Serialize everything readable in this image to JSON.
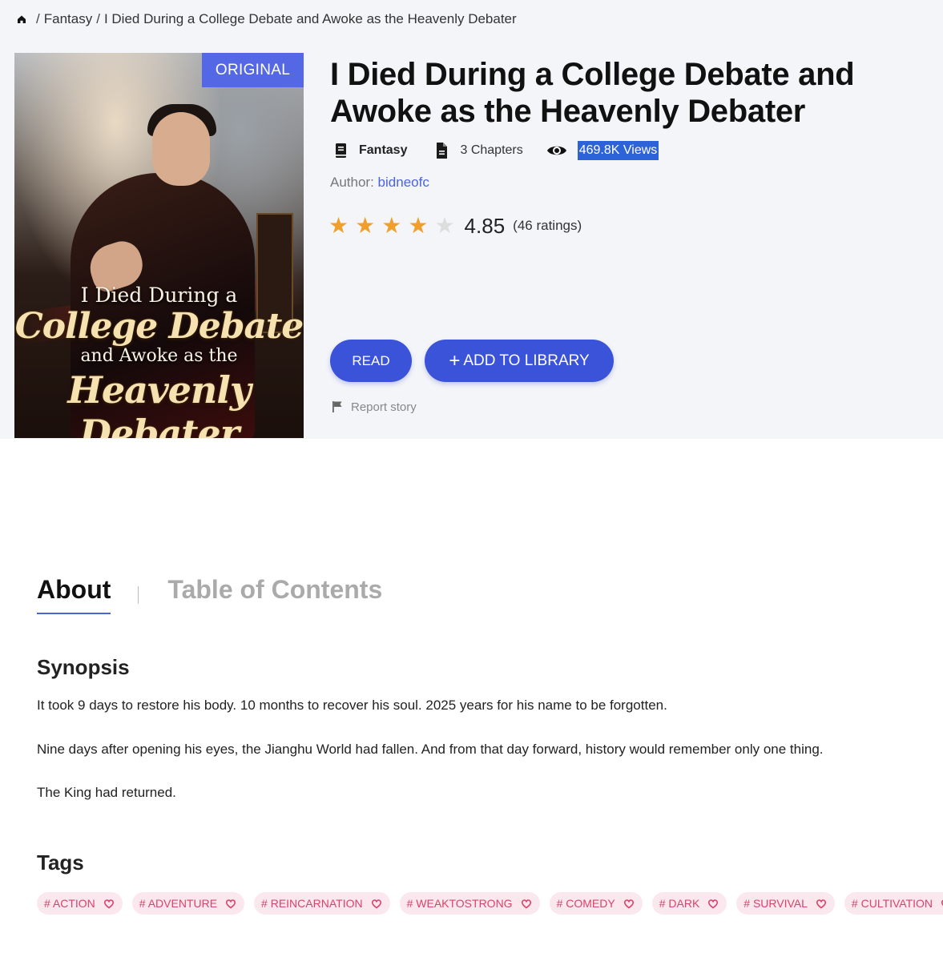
{
  "breadcrumb": {
    "items": [
      "Fantasy",
      "I Died During a College Debate and Awoke as the Heavenly Debater"
    ]
  },
  "cover": {
    "badge": "ORIGINAL",
    "lines": [
      "I Died During a",
      "College Debate",
      "and Awoke as the",
      "Heavenly Debater"
    ]
  },
  "book": {
    "title": "I Died During a College Debate and Awoke as the Heavenly Debater",
    "genre": "Fantasy",
    "chapters": "3 Chapters",
    "views": "469.8K Views",
    "author_label": "Author:",
    "author": "bidneofc",
    "rating": {
      "stars_filled": 4,
      "stars_total": 5,
      "score": "4.85",
      "count": "(46 ratings)"
    }
  },
  "actions": {
    "read": "READ",
    "add_plus": "+",
    "add_to_library": "ADD TO LIBRARY",
    "report": "Report story"
  },
  "tabs": [
    {
      "label": "About",
      "active": true
    },
    {
      "label": "Table of Contents",
      "active": false
    }
  ],
  "synopsis": {
    "heading": "Synopsis",
    "paragraphs": [
      "It took 9 days to restore his body. 10 months to recover his soul. 2025 years for his name to be forgotten.",
      "Nine days after opening his eyes, the Jianghu World had fallen. And from that day forward, history would remember only one thing.",
      "The King had returned."
    ]
  },
  "tags": {
    "heading": "Tags",
    "items": [
      "# ACTION",
      "# ADVENTURE",
      "# REINCARNATION",
      "# WEAKTOSTRONG",
      "# COMEDY",
      "# DARK",
      "# SURVIVAL",
      "# CULTIVATION"
    ]
  },
  "colors": {
    "accent": "#3a53d8",
    "badge": "#5468e6",
    "star": "#f0a02a",
    "tag_bg": "#fbe7ee",
    "tag_text": "#d8436b",
    "link": "#4a64dc"
  },
  "icons": [
    "home-icon",
    "book-icon",
    "document-icon",
    "eye-icon",
    "star-icon",
    "flag-icon",
    "heart-icon"
  ]
}
